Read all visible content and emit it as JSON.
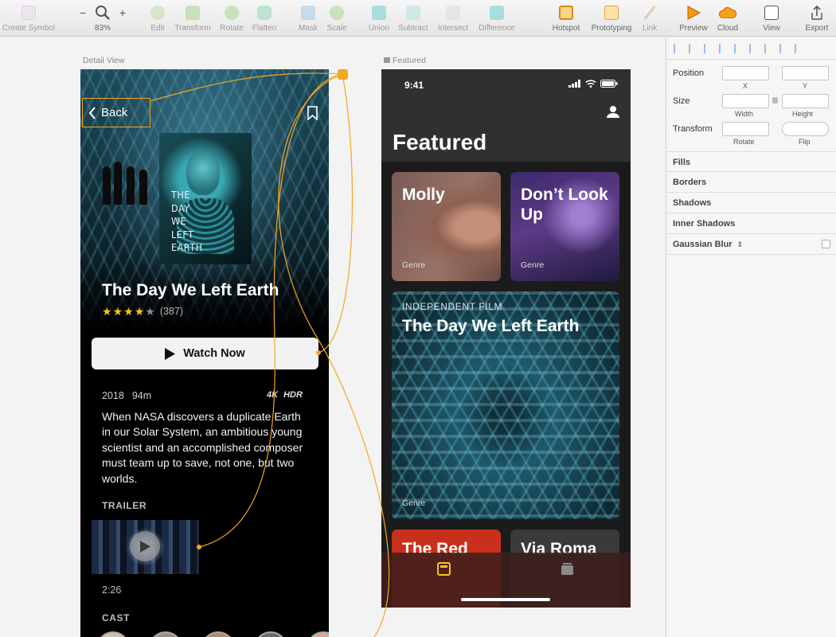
{
  "toolbar": {
    "items": [
      {
        "label": "Create Symbol",
        "icon": "create-symbol-icon"
      },
      {
        "label": "83%",
        "icon": "zoom-icon"
      },
      {
        "label": "Edit",
        "icon": "edit-icon"
      },
      {
        "label": "Transform",
        "icon": "transform-icon"
      },
      {
        "label": "Rotate",
        "icon": "rotate-icon"
      },
      {
        "label": "Flatten",
        "icon": "flatten-icon"
      },
      {
        "label": "Mask",
        "icon": "mask-icon"
      },
      {
        "label": "Scale",
        "icon": "scale-icon"
      },
      {
        "label": "Union",
        "icon": "union-icon"
      },
      {
        "label": "Subtract",
        "icon": "subtract-icon"
      },
      {
        "label": "Intersect",
        "icon": "intersect-icon"
      },
      {
        "label": "Difference",
        "icon": "difference-icon"
      },
      {
        "label": "Hotspot",
        "icon": "hotspot-icon"
      },
      {
        "label": "Prototyping",
        "icon": "prototyping-icon"
      },
      {
        "label": "Link",
        "icon": "link-icon"
      },
      {
        "label": "Preview",
        "icon": "preview-icon"
      },
      {
        "label": "Cloud",
        "icon": "cloud-icon"
      },
      {
        "label": "View",
        "icon": "view-icon"
      },
      {
        "label": "Export",
        "icon": "export-icon"
      }
    ],
    "zoom_minus": "−",
    "zoom_plus": "+"
  },
  "artboards": {
    "detail_label": "Detail View",
    "featured_label": "Featured"
  },
  "detail": {
    "back_label": "Back",
    "poster_title": [
      "THE",
      "DAY",
      "WE",
      "LEFT",
      "EARTH"
    ],
    "title": "The Day We Left Earth",
    "rating_count": "(387)",
    "stars_filled": 4,
    "stars_total": 5,
    "watch_label": "Watch Now",
    "year": "2018",
    "runtime": "94m",
    "badge_4k": "4K",
    "badge_hdr": "HDR",
    "synopsis": "When NASA discovers a duplicate Earth in our Solar System, an ambitious young scientist and an accomplished composer must team up to save, not one, but two worlds.",
    "trailer_heading": "TRAILER",
    "trailer_duration": "2:26",
    "cast_heading": "CAST"
  },
  "featured": {
    "time": "9:41",
    "title": "Featured",
    "cards": [
      {
        "title": "Molly",
        "genre": "Genre"
      },
      {
        "title": "Don’t Look Up",
        "genre": "Genre"
      },
      {
        "kicker": "INDEPENDENT FILM",
        "title": "The Day We Left Earth",
        "genre": "Genre"
      },
      {
        "title": "The Red"
      },
      {
        "title": "Via Roma"
      }
    ]
  },
  "inspector": {
    "position_label": "Position",
    "x_label": "X",
    "y_label": "Y",
    "size_label": "Size",
    "width_label": "Width",
    "height_label": "Height",
    "transform_label": "Transform",
    "rotate_label": "Rotate",
    "flip_label": "Flip",
    "sections": [
      "Fills",
      "Borders",
      "Shadows",
      "Inner Shadows",
      "Gaussian Blur"
    ]
  },
  "colors": {
    "accent": "#f5a623",
    "star": "#f5c518",
    "star_empty": "#8a8a8a"
  }
}
